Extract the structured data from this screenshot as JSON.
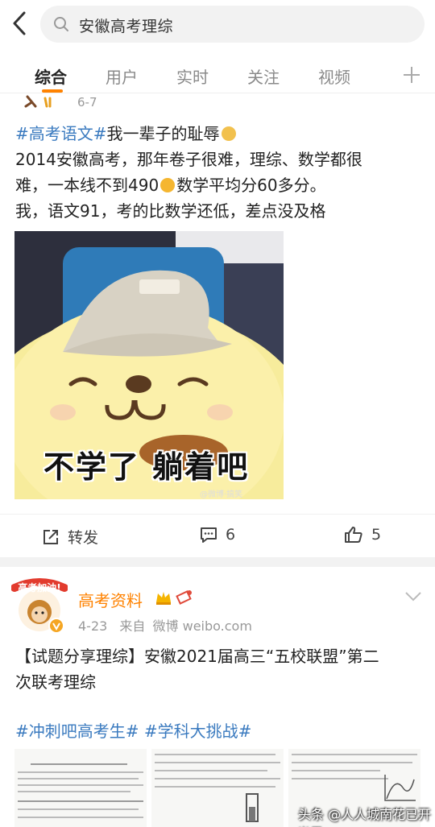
{
  "search": {
    "query": "安徽高考理综"
  },
  "tabs": [
    "综合",
    "用户",
    "实时",
    "关注",
    "视频"
  ],
  "prev_post": {
    "date": "6-7"
  },
  "post1": {
    "hashtag": "#高考语文#",
    "line1_rest": "我一辈子的耻辱",
    "line2": "2014安徽高考，那年卷子很难，理综、数学都很",
    "line3_a": "难，一本线不到490",
    "line3_b": "数学平均分60多分。",
    "line4": "我，语文91，考的比数学还低，差点没及格",
    "image_caption": "不学了 躺着吧",
    "image_watermark": "@微博·搞笑",
    "actions": {
      "repost_label": "转发",
      "comment_count": "6",
      "like_count": "5"
    }
  },
  "post2": {
    "author": "高考资料",
    "avatar_text": "高考加油!",
    "date": "4-23",
    "source_prefix": "来自",
    "source": "微博 weibo.com",
    "text_line1": "【试题分享理综】安徽2021届高三“五校联盟”第二",
    "text_line2": "次联考理综",
    "hashtags": "#冲刺吧高考生# #学科大挑战#"
  },
  "page_watermark": "头条 @人人城南花已开半里",
  "colors": {
    "accent": "#ff8200",
    "link": "#3a7abf"
  }
}
